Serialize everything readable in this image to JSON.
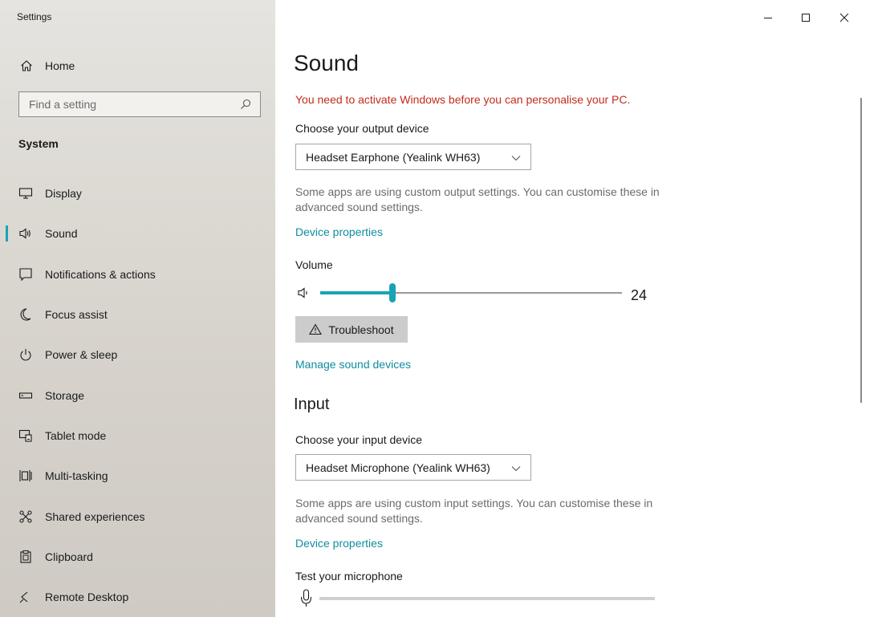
{
  "window": {
    "app_title": "Settings"
  },
  "sidebar": {
    "home_label": "Home",
    "search_placeholder": "Find a setting",
    "section_label": "System",
    "items": [
      {
        "label": "Display",
        "icon": "display-icon",
        "active": false
      },
      {
        "label": "Sound",
        "icon": "speaker-icon",
        "active": true
      },
      {
        "label": "Notifications & actions",
        "icon": "notification-icon",
        "active": false
      },
      {
        "label": "Focus assist",
        "icon": "moon-icon",
        "active": false
      },
      {
        "label": "Power & sleep",
        "icon": "power-icon",
        "active": false
      },
      {
        "label": "Storage",
        "icon": "storage-icon",
        "active": false
      },
      {
        "label": "Tablet mode",
        "icon": "tablet-mode-icon",
        "active": false
      },
      {
        "label": "Multi-tasking",
        "icon": "multitasking-icon",
        "active": false
      },
      {
        "label": "Shared experiences",
        "icon": "shared-experiences-icon",
        "active": false
      },
      {
        "label": "Clipboard",
        "icon": "clipboard-icon",
        "active": false
      },
      {
        "label": "Remote Desktop",
        "icon": "remote-desktop-icon",
        "active": false
      }
    ]
  },
  "main": {
    "title": "Sound",
    "activation_warning": "You need to activate Windows before you can personalise your PC.",
    "output": {
      "choose_label": "Choose your output device",
      "selected_device": "Headset Earphone (Yealink WH63)",
      "help_text": "Some apps are using custom output settings. You can customise these in advanced sound settings.",
      "device_properties_link": "Device properties",
      "volume_label": "Volume",
      "volume_value": "24",
      "volume_fraction": 0.24,
      "troubleshoot_label": "Troubleshoot",
      "manage_devices_link": "Manage sound devices"
    },
    "input": {
      "heading": "Input",
      "choose_label": "Choose your input device",
      "selected_device": "Headset Microphone (Yealink WH63)",
      "help_text": "Some apps are using custom input settings. You can customise these in advanced sound settings.",
      "device_properties_link": "Device properties",
      "test_label": "Test your microphone",
      "mic_level": 0
    }
  },
  "colors": {
    "accent": "#1aa3b7",
    "link": "#0f8da0",
    "warning": "#c42b1c"
  }
}
